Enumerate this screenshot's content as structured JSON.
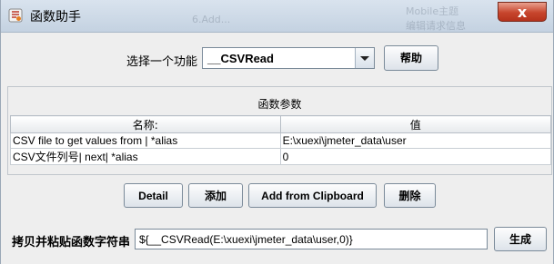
{
  "window": {
    "title": "函数助手",
    "close_symbol": "x",
    "background_ghost": [
      "Mobile主题",
      "编辑请求信息",
      "6.Add..."
    ]
  },
  "function_select": {
    "label": "选择一个功能",
    "selected": "__CSVRead"
  },
  "help_button": "帮助",
  "params": {
    "title": "函数参数",
    "columns": [
      "名称:",
      "值"
    ],
    "rows": [
      {
        "name": "CSV file to get values from | *alias",
        "value": "E:\\xuexi\\jmeter_data\\user"
      },
      {
        "name": "CSV文件列号| next| *alias",
        "value": "0"
      }
    ]
  },
  "buttons": {
    "detail": "Detail",
    "add": "添加",
    "add_clipboard": "Add from Clipboard",
    "delete": "删除",
    "generate": "生成"
  },
  "result": {
    "label": "拷贝并粘贴函数字符串",
    "value": "${__CSVRead(E:\\xuexi\\jmeter_data\\user,0)}"
  },
  "colors": {
    "titlebar": "#c4d2e1",
    "close_button": "#c7452d",
    "panel_background": "#eeeeee"
  }
}
